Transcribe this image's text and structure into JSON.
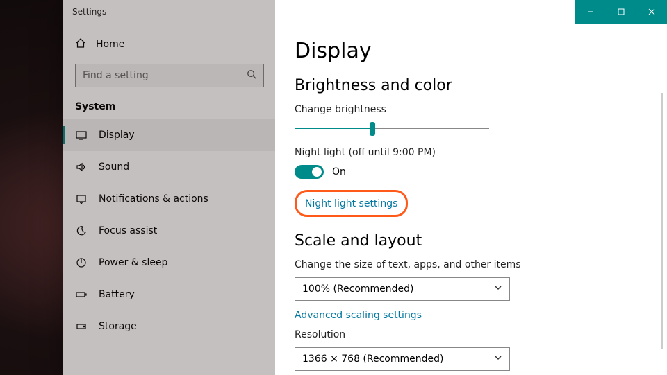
{
  "window": {
    "title": "Settings"
  },
  "sidebar": {
    "home_label": "Home",
    "search_placeholder": "Find a setting",
    "section_label": "System",
    "items": [
      {
        "label": "Display",
        "icon": "display"
      },
      {
        "label": "Sound",
        "icon": "sound"
      },
      {
        "label": "Notifications & actions",
        "icon": "notifications"
      },
      {
        "label": "Focus assist",
        "icon": "moon"
      },
      {
        "label": "Power & sleep",
        "icon": "power"
      },
      {
        "label": "Battery",
        "icon": "battery"
      },
      {
        "label": "Storage",
        "icon": "storage"
      }
    ]
  },
  "content": {
    "page_title": "Display",
    "section_brightness": "Brightness and color",
    "brightness_label": "Change brightness",
    "brightness_percent": 40,
    "night_light_label": "Night light (off until 9:00 PM)",
    "night_light_on": true,
    "night_light_state": "On",
    "night_light_settings_link": "Night light settings",
    "section_scale": "Scale and layout",
    "scale_label": "Change the size of text, apps, and other items",
    "scale_value": "100% (Recommended)",
    "advanced_scaling_link": "Advanced scaling settings",
    "resolution_label": "Resolution",
    "resolution_value": "1366 × 768 (Recommended)"
  },
  "colors": {
    "accent": "#008b8b",
    "highlight": "#ff5a1a"
  }
}
